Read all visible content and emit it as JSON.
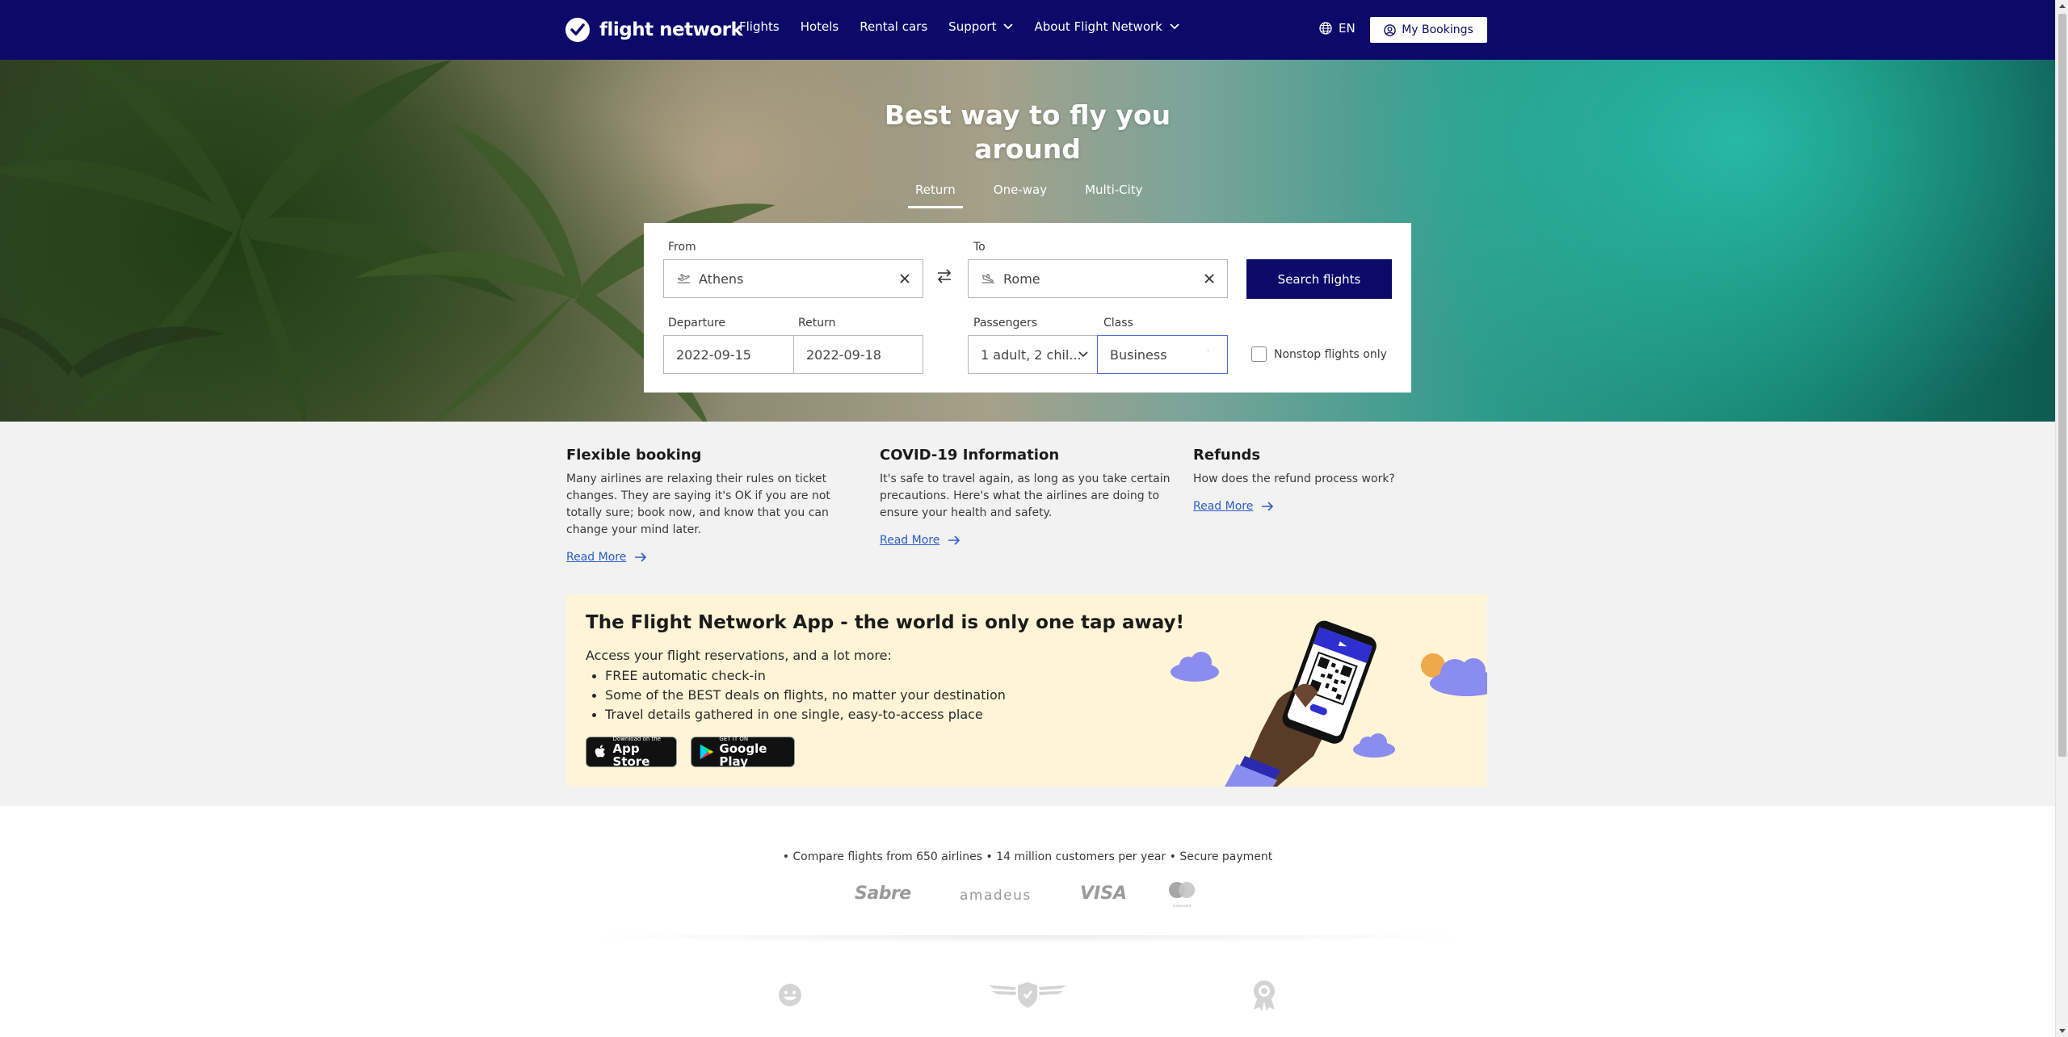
{
  "header": {
    "brand": "flight network",
    "nav": [
      {
        "label": "Flights"
      },
      {
        "label": "Hotels"
      },
      {
        "label": "Rental cars"
      },
      {
        "label": "Support"
      },
      {
        "label": "About Flight Network"
      }
    ],
    "language": "EN",
    "my_bookings": "My Bookings"
  },
  "hero": {
    "title": "Best way to fly you around",
    "trip_types": [
      "Return",
      "One-way",
      "Multi-City"
    ],
    "active_trip_type": "Return"
  },
  "search": {
    "from_label": "From",
    "from_value": "Athens",
    "to_label": "To",
    "to_value": "Rome",
    "search_button": "Search flights",
    "departure_label": "Departure",
    "departure_value": "2022-09-15",
    "return_label": "Return",
    "return_value": "2022-09-18",
    "passengers_label": "Passengers",
    "passengers_value": "1 adult, 2 chil...",
    "class_label": "Class",
    "class_value": "Business",
    "nonstop_label": "Nonstop flights only",
    "nonstop_checked": false
  },
  "info": [
    {
      "title": "Flexible booking",
      "body": "Many airlines are relaxing their rules on ticket changes. They are saying it's OK if you are not totally sure; book now, and know that you can change your mind later.",
      "link": "Read More"
    },
    {
      "title": "COVID-19 Information",
      "body": "It's safe to travel again, as long as you take certain precautions. Here's what the airlines are doing to ensure your health and safety.",
      "link": "Read More"
    },
    {
      "title": "Refunds",
      "body": "How does the refund process work?",
      "link": "Read More"
    }
  ],
  "app_promo": {
    "title": "The Flight Network App - the world is only one tap away!",
    "intro": "Access your flight reservations, and a lot more:",
    "bullets": [
      "FREE automatic check-in",
      "Some of the BEST deals on flights, no matter your destination",
      "Travel details gathered in one single, easy-to-access place"
    ],
    "app_store": {
      "small": "Download on the",
      "big": "App Store"
    },
    "google_play": {
      "small": "GET IT ON",
      "big": "Google Play"
    }
  },
  "trust": {
    "line": "• Compare flights from 650 airlines  • 14 million customers per year  • Secure payment",
    "partners": [
      "Sabre",
      "amadeus",
      "VISA",
      "mastercard"
    ]
  },
  "colors": {
    "brand_navy": "#0b0a69",
    "link_blue": "#2a5ec8",
    "promo_bg": "#fff4d6",
    "cloud": "#8a8cf0"
  }
}
